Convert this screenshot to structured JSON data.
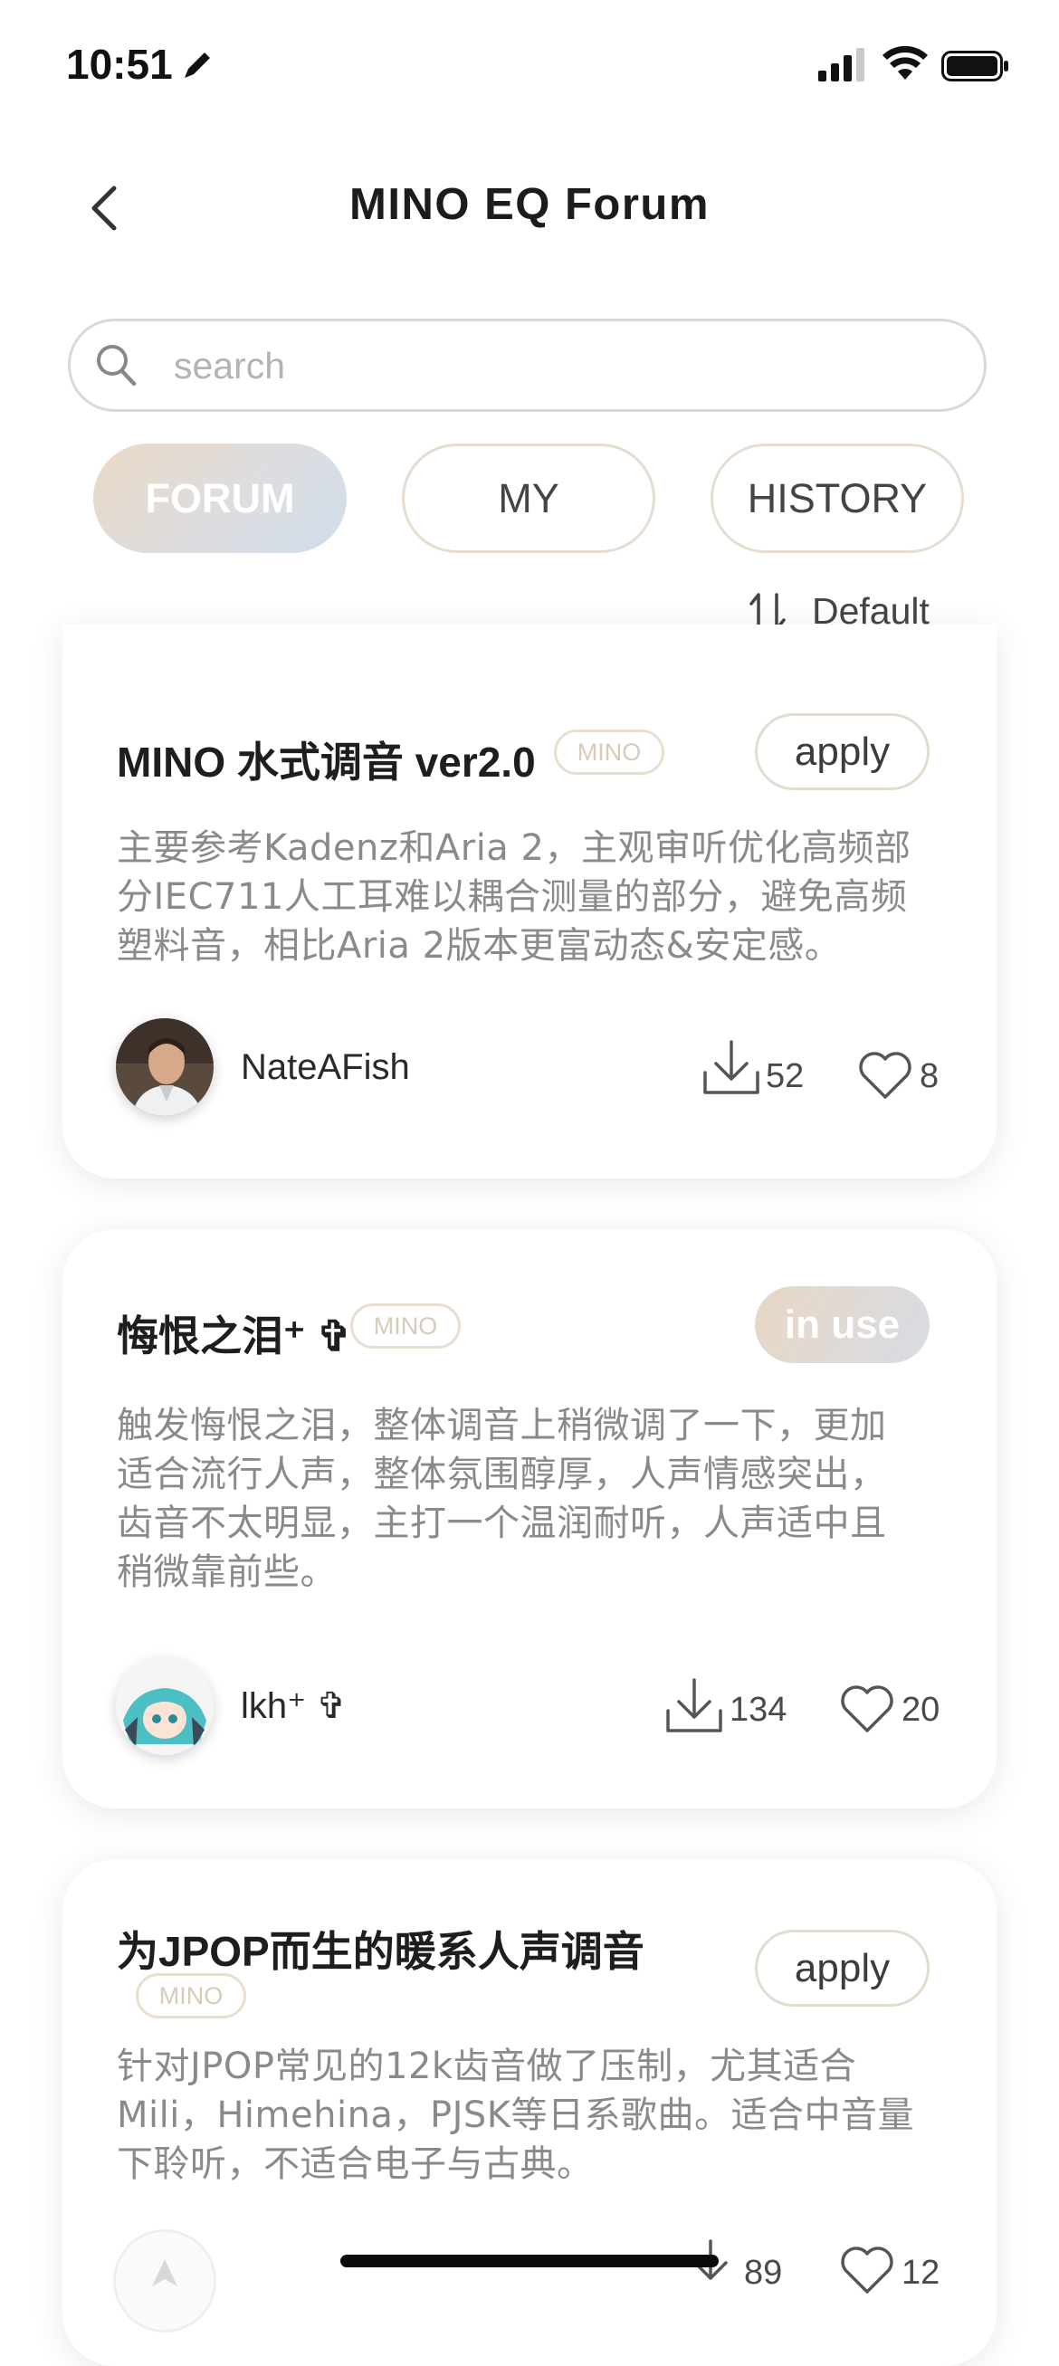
{
  "status_bar": {
    "time": "10:51"
  },
  "header": {
    "title": "MINO EQ Forum"
  },
  "search": {
    "placeholder": "search",
    "value": ""
  },
  "tabs": [
    {
      "label": "FORUM",
      "active": true
    },
    {
      "label": "MY",
      "active": false
    },
    {
      "label": "HISTORY",
      "active": false
    }
  ],
  "sort": {
    "label": "Default"
  },
  "posts": [
    {
      "title": "MINO 水式调音 ver2.0",
      "tag": "MINO",
      "action": "apply",
      "desc_lines": [
        "主要参考Kadenz和Aria 2，主观审听优化高频部",
        "分IEC711人工耳难以耦合测量的部分，避免高频",
        "塑料音，相比Aria 2版本更富动态&安定感。"
      ],
      "author": "NateAFish",
      "downloads": "52",
      "likes": "8"
    },
    {
      "title": "悔恨之泪⁺ ✞",
      "tag": "MINO",
      "action": "in use",
      "desc_lines": [
        "触发悔恨之泪，整体调音上稍微调了一下，更加",
        "适合流行人声，整体氛围醇厚，人声情感突出，",
        "齿音不太明显，主打一个温润耐听，人声适中且",
        "稍微靠前些。"
      ],
      "author": "lkh⁺ ✞",
      "downloads": "134",
      "likes": "20"
    },
    {
      "title": "为JPOP而生的暖系人声调音",
      "tag": "MINO",
      "action": "apply",
      "desc_lines": [
        "针对JPOP常见的12k齿音做了压制，尤其适合",
        "Mili，Himehina，PJSK等日系歌曲。适合中音量",
        "下聆听，不适合电子与古典。"
      ],
      "author": "",
      "downloads": "89",
      "likes": "12"
    }
  ],
  "colors": {
    "accent_gradient_start": "#ead9c6",
    "accent_gradient_end": "#d0dde9",
    "tag_border": "#eadfce",
    "desc_text": "#8a8a8a"
  }
}
